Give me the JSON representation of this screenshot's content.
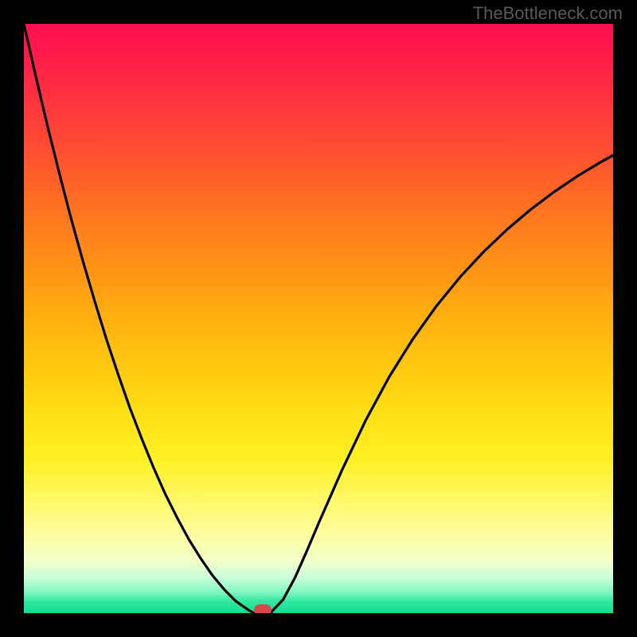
{
  "watermark": "TheBottleneck.com",
  "chart_data": {
    "type": "line",
    "title": "",
    "xlabel": "",
    "ylabel": "",
    "x": [
      0.0,
      0.02,
      0.04,
      0.06,
      0.08,
      0.1,
      0.12,
      0.14,
      0.16,
      0.18,
      0.2,
      0.22,
      0.24,
      0.26,
      0.28,
      0.3,
      0.32,
      0.34,
      0.36,
      0.38,
      0.39,
      0.4,
      0.41,
      0.42,
      0.44,
      0.46,
      0.48,
      0.5,
      0.54,
      0.58,
      0.62,
      0.66,
      0.7,
      0.74,
      0.78,
      0.82,
      0.86,
      0.9,
      0.94,
      0.98,
      1.0
    ],
    "y": [
      1.0,
      0.912,
      0.827,
      0.747,
      0.67,
      0.598,
      0.53,
      0.465,
      0.405,
      0.348,
      0.296,
      0.247,
      0.202,
      0.162,
      0.125,
      0.093,
      0.064,
      0.04,
      0.02,
      0.006,
      0.0,
      0.0,
      0.0,
      0.002,
      0.023,
      0.06,
      0.105,
      0.152,
      0.243,
      0.327,
      0.401,
      0.465,
      0.521,
      0.57,
      0.613,
      0.651,
      0.685,
      0.715,
      0.742,
      0.766,
      0.777
    ],
    "xlim": [
      0,
      1
    ],
    "ylim": [
      0,
      1
    ],
    "marker": {
      "x": 0.405,
      "y": 0.0
    },
    "background_gradient": {
      "direction": "vertical",
      "stops": [
        {
          "pos": 0.0,
          "color": "#ff1050"
        },
        {
          "pos": 0.5,
          "color": "#ffb010"
        },
        {
          "pos": 0.8,
          "color": "#fff860"
        },
        {
          "pos": 1.0,
          "color": "#10de90"
        }
      ]
    }
  }
}
